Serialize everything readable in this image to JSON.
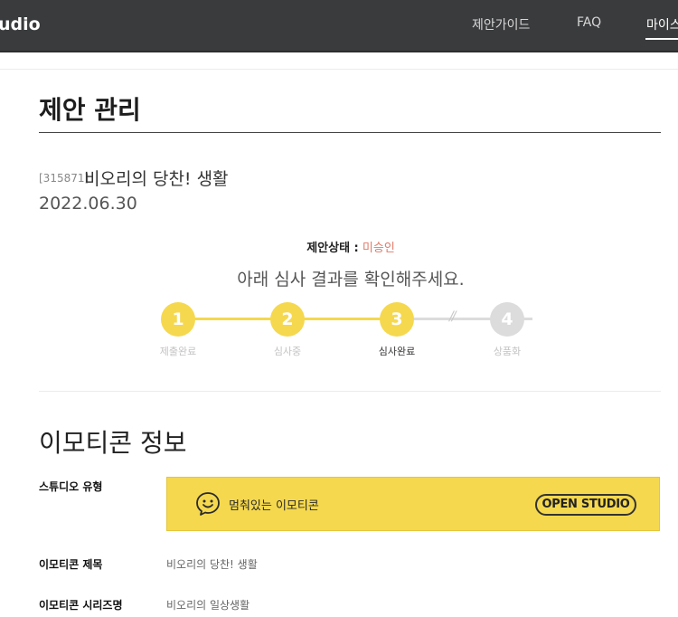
{
  "header": {
    "brand": "udio",
    "nav": [
      {
        "label": "제안가이드"
      },
      {
        "label": "FAQ"
      },
      {
        "label": "마이스"
      }
    ]
  },
  "page": {
    "title": "제안 관리"
  },
  "proposal": {
    "code": "[315871]",
    "name": "비오리의 당찬! 생활",
    "date": "2022.06.30",
    "status_label": "제안상태 :",
    "status_value": "미승인",
    "review_message": "아래 심사 결과를 확인해주세요."
  },
  "stepper": {
    "steps": [
      {
        "number": "1",
        "label": "제출완료",
        "state": "done"
      },
      {
        "number": "2",
        "label": "심사중",
        "state": "done"
      },
      {
        "number": "3",
        "label": "심사완료",
        "state": "current"
      },
      {
        "number": "4",
        "label": "상품화",
        "state": "todo"
      }
    ],
    "divider_glyph": "//"
  },
  "emoticon_info": {
    "section_title": "이모티콘 정보",
    "studio_type_label": "스튜디오 유형",
    "studio_type_value": "멈춰있는 이모티콘",
    "studio_badge": "OPEN STUDIO",
    "title_label": "이모티콘 제목",
    "title_value": "비오리의 당찬! 생활",
    "series_label": "이모티콘 시리즈명",
    "series_value": "비오리의 일상생활"
  },
  "colors": {
    "accent_yellow": "#f5d84e",
    "status_red": "#e07a67",
    "header_bg": "#3a3b3d"
  }
}
